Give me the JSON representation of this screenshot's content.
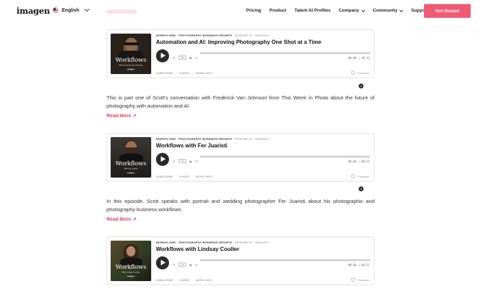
{
  "header": {
    "logo": "imagen",
    "language": "English",
    "nav": [
      {
        "label": "Pricing",
        "dropdown": false
      },
      {
        "label": "Product",
        "dropdown": false
      },
      {
        "label": "Talent AI Profiles",
        "dropdown": false
      },
      {
        "label": "Company",
        "dropdown": true
      },
      {
        "label": "Community",
        "dropdown": true
      },
      {
        "label": "Support",
        "dropdown": false
      }
    ],
    "cta": "Get Started"
  },
  "episodes": [
    {
      "meta_show": "WORKFLOWS - PHOTOGRAPHY BUSINESS GROWTH",
      "meta_ep": " - EPISODE 21 - SEASON 2",
      "title": "Automation and AI: Improving Photography One Shot at a Time",
      "time": "00:00 | 48:13",
      "speed": "1x",
      "subscribe": "SUBSCRIBE",
      "share": "SHARE",
      "more_info": "MORE INFO",
      "podcaster": "Podcaster",
      "cover_title": "Workflows",
      "cover_sub": "With Frederick Van Johnson",
      "cover_mark": "imagen",
      "description": "This is part one of Scott's conversation with Frederick Van Johnson from This Week in Photo about the future of photography with automation and AI.",
      "read_more": "Read More"
    },
    {
      "meta_show": "WORKFLOWS - PHOTOGRAPHY BUSINESS GROWTH",
      "meta_ep": " - EPISODE 20 - SEASON 2",
      "title": "Workflows with Fer Juaristi",
      "time": "00:00 | 40:32",
      "speed": "1x",
      "subscribe": "SUBSCRIBE",
      "share": "SHARE",
      "more_info": "MORE INFO",
      "podcaster": "Podcaster",
      "cover_title": "Workflows",
      "cover_sub": "With Fer Juaristi",
      "cover_mark": "imagen",
      "description": "In this episode, Scott speaks with portrait and wedding photographer Fer Juaristi about his photographic and photography business workflows.",
      "read_more": "Read More"
    },
    {
      "meta_show": "WORKFLOWS - PHOTOGRAPHY BUSINESS GROWTH",
      "meta_ep": " - EPISODE 19 - SEASON 2",
      "title": "Workflows with Lindsay Coulter",
      "time": "00:00 | 46:31",
      "speed": "1x",
      "subscribe": "SUBSCRIBE",
      "share": "SHARE",
      "more_info": "MORE INFO",
      "podcaster": "Podcaster",
      "cover_title": "Workflows",
      "cover_sub": "With Lindsay Coulter",
      "cover_mark": "imagen"
    }
  ],
  "icons": {
    "platform_1": "spotify-icon",
    "platform_2": "apple-podcasts-icon"
  },
  "colors": {
    "accent": "#f05a73",
    "read_more": "#e0465f"
  }
}
